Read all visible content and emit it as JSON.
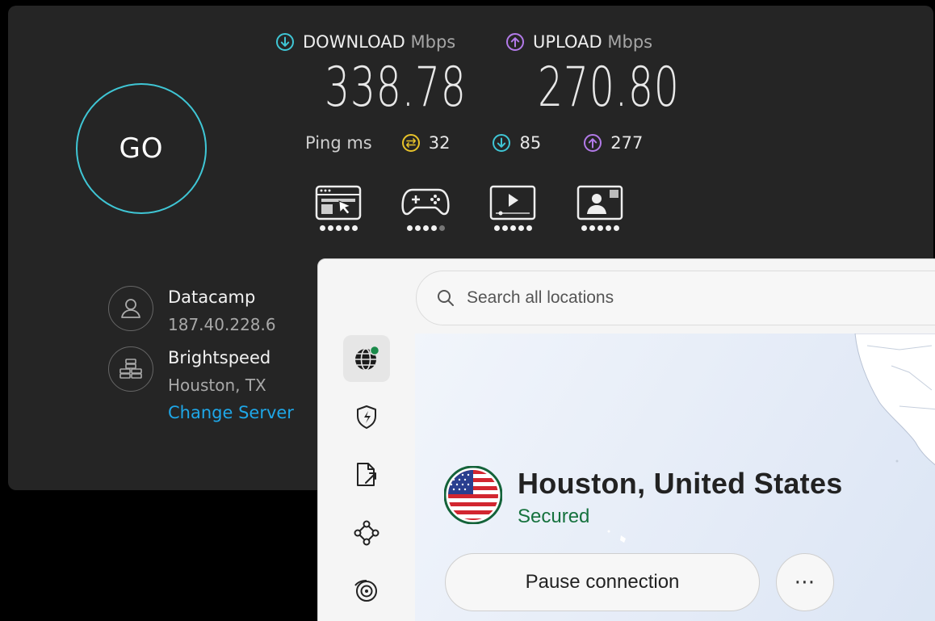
{
  "speedtest": {
    "go_label": "GO",
    "download": {
      "label": "DOWNLOAD",
      "unit": "Mbps",
      "value": "338.78",
      "icon": "download-arrow-icon",
      "color": "#3fc6d5"
    },
    "upload": {
      "label": "UPLOAD",
      "unit": "Mbps",
      "value": "270.80",
      "icon": "upload-arrow-icon",
      "color": "#b27ae8"
    },
    "ping": {
      "label": "Ping ms",
      "idle": {
        "value": "32",
        "icon": "ping-idle-icon",
        "color": "#e8c32a"
      },
      "download": {
        "value": "85",
        "icon": "download-arrow-icon",
        "color": "#3fc6d5"
      },
      "upload": {
        "value": "277",
        "icon": "upload-arrow-icon",
        "color": "#b27ae8"
      }
    },
    "activities": [
      {
        "name": "web-browsing-icon",
        "rating": 5,
        "max": 5
      },
      {
        "name": "gaming-icon",
        "rating": 4,
        "max": 5
      },
      {
        "name": "video-streaming-icon",
        "rating": 5,
        "max": 5
      },
      {
        "name": "video-call-icon",
        "rating": 5,
        "max": 5
      }
    ],
    "provider": {
      "name": "Datacamp",
      "ip": "187.40.228.6",
      "icon": "user-icon"
    },
    "server": {
      "name": "Brightspeed",
      "location": "Houston, TX",
      "change_label": "Change Server",
      "icon": "server-icon"
    }
  },
  "vpn": {
    "search": {
      "placeholder": "Search all locations",
      "icon": "search-icon"
    },
    "sidebar": [
      {
        "name": "globe-icon",
        "active": true
      },
      {
        "name": "threat-protection-icon",
        "active": false
      },
      {
        "name": "file-share-icon",
        "active": false
      },
      {
        "name": "meshnet-icon",
        "active": false
      },
      {
        "name": "dark-web-monitor-icon",
        "active": false
      }
    ],
    "connection": {
      "location": "Houston, United States",
      "status": "Secured",
      "flag": "us-flag-icon",
      "pause_label": "Pause connection",
      "more_label": "⋯"
    }
  }
}
